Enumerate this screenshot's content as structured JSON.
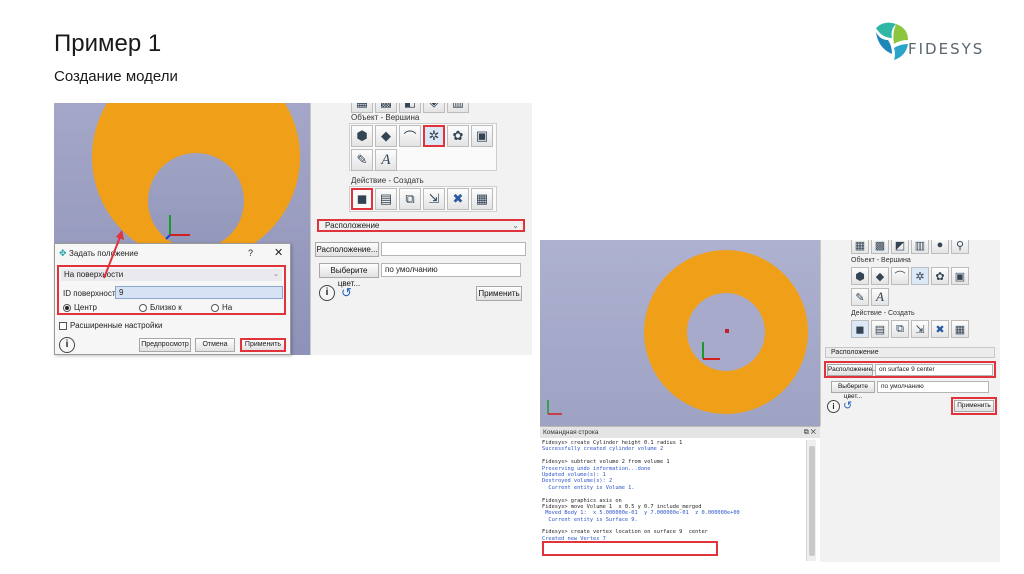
{
  "slide": {
    "title": "Пример 1",
    "subtitle": "Создание модели",
    "logo_text": "FIDESYS"
  },
  "colors": {
    "accent_red": "#e0333c",
    "model_orange": "#f0a018",
    "viewport_blue": "#9ea2c3",
    "output_blue": "#2a55c8"
  },
  "panel1": {
    "section_object": "Объект - Вершина",
    "section_action": "Действие - Создать",
    "dropdown": "Расположение",
    "location_button": "Расположение...",
    "location_value": "",
    "color_button": "Выберите цвет...",
    "color_value": "по умолчанию",
    "apply_button": "Применить",
    "object_icons": [
      "volume-icon",
      "surface-icon",
      "curve-icon",
      "vertex-icon",
      "group-icon",
      "part-icon"
    ],
    "object_icons_row2": [
      "measure-icon",
      "text-A-icon"
    ],
    "action_icons": [
      "create-icon",
      "edit-icon",
      "copy-icon",
      "delete-icon",
      "merge-icon",
      "info-icon"
    ]
  },
  "dialog": {
    "title": "Задать положение",
    "help": "?",
    "close": "✕",
    "mode": "На поверхности",
    "id_label": "ID поверхности",
    "id_value": "9",
    "radio_center": "Центр",
    "radio_near": "Близко к",
    "radio_on": "На",
    "checkbox_advanced": "Расширенные настройки",
    "btn_preview": "Предпросмотр",
    "btn_cancel": "Отмена",
    "btn_apply": "Применить"
  },
  "panel2": {
    "section_object": "Объект - Вершина",
    "section_action": "Действие - Создать",
    "dropdown": "Расположение",
    "location_button": "Расположение...",
    "location_value": "on surface 9  center",
    "color_button": "Выберите цвет...",
    "color_value": "по умолчанию",
    "apply_button": "Применить"
  },
  "console": {
    "title": "Командная строка",
    "lines": [
      {
        "t": "Fidesys> create Cylinder height 0.1 radius 1",
        "k": "cmd"
      },
      {
        "t": "Successfully created cylinder volume 2",
        "k": "out"
      },
      {
        "t": "",
        "k": "gap"
      },
      {
        "t": "Fidesys> subtract volume 2 from volume 1",
        "k": "cmd"
      },
      {
        "t": "Preserving undo information...done",
        "k": "out"
      },
      {
        "t": "Updated volume(s): 1",
        "k": "out"
      },
      {
        "t": "Destroyed volume(s): 2",
        "k": "out"
      },
      {
        "t": "  Current entity is Volume 1.",
        "k": "out"
      },
      {
        "t": "",
        "k": "gap"
      },
      {
        "t": "Fidesys> graphics axis on",
        "k": "cmd"
      },
      {
        "t": "Fidesys> move Volume 1  x 0.5 y 0.7 include_merged",
        "k": "cmd"
      },
      {
        "t": " Moved Body 1:  x 5.000000e-01  y 7.000000e-01  z 0.000000e+00",
        "k": "out"
      },
      {
        "t": "  Current entity is Surface 9.",
        "k": "out"
      },
      {
        "t": "",
        "k": "gap"
      },
      {
        "t": "Fidesys> create vertex location on surface 9  center",
        "k": "cmd"
      },
      {
        "t": "Created new Vertex 7",
        "k": "out"
      }
    ]
  }
}
